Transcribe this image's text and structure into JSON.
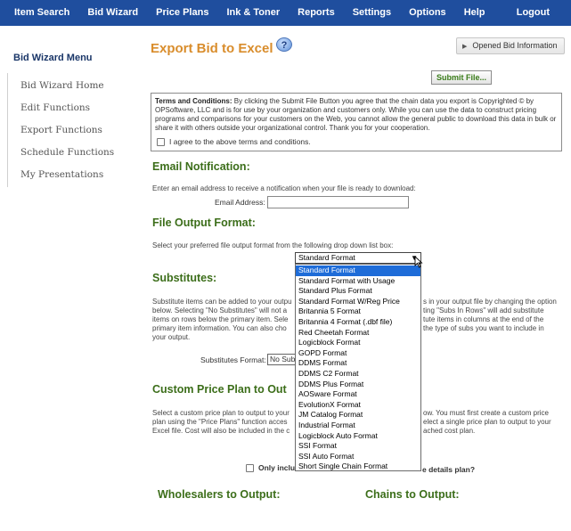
{
  "nav": {
    "items": [
      "Item Search",
      "Bid Wizard",
      "Price Plans",
      "Ink & Toner",
      "Reports",
      "Settings",
      "Options",
      "Help"
    ],
    "logout": "Logout",
    "bg_color": "#1f4e9e"
  },
  "sidebar": {
    "title": "Bid Wizard Menu",
    "items": [
      "Bid Wizard Home",
      "Edit Functions",
      "Export Functions",
      "Schedule Functions",
      "My Presentations"
    ]
  },
  "main": {
    "title": "Export Bid to Excel",
    "help_icon": "?",
    "opened_bid_label": "Opened Bid Information",
    "submit_label": "Submit File...",
    "terms": {
      "heading": "Terms and Conditions:",
      "body": " By clicking the Submit File Button you agree that the chain data you export is Copyrighted © by OPSoftware, LLC and is for use by your organization and customers only. While you can use the data to construct pricing programs and comparisons for your customers on the Web, you cannot allow the general public to download this data in bulk or share it with others outside your organizational control. Thank you for your cooperation.",
      "agree_label": "I agree to the above terms and conditions."
    },
    "email": {
      "heading": "Email Notification:",
      "instructions": "Enter an email address to receive a notification when your file is ready to download:",
      "label": "Email Address:",
      "value": ""
    },
    "file_output": {
      "heading": "File Output Format:",
      "instructions": "Select your preferred file output format from the following drop down list box:",
      "selected": "Standard Format",
      "options": [
        "Standard Format",
        "Standard Format with Usage",
        "Standard Plus Format",
        "Standard Format W/Reg Price",
        "Britannia 5 Format",
        "Britannia 4 Format (.dbf file)",
        "Red Cheetah Format",
        "Logicblock Format",
        "GOPD Format",
        "DDMS Format",
        "DDMS C2 Format",
        "DDMS Plus Format",
        "AOSware Format",
        "EvolutionX Format",
        "JM Catalog Format",
        "Industrial Format",
        "Logicblock Auto Format",
        "SSI Format",
        "SSI Auto Format",
        "Short Single Chain Format"
      ]
    },
    "substitutes": {
      "heading": "Substitutes:",
      "text_left_1": "Substitute items can be added to your outpu",
      "text_right_1": "s in your output file by changing the option",
      "text_left_2": "below. Selecting \"No Substitutes\" will not a",
      "text_right_2": "ting \"Subs In Rows\" will add substitute",
      "text_left_3": "items on rows below the primary item. Sele",
      "text_right_3": "tute items in columns at the end of the",
      "text_left_4": "primary item information. You can also cho",
      "text_right_4": "the type of subs you want to include in",
      "text_left_5": "your output.",
      "format_label": "Substitutes Format:",
      "format_value": "No Sub"
    },
    "custom_plan": {
      "heading": "Custom Price Plan to Out",
      "text_left_1": "Select a custom price plan to output to your",
      "text_right_1": "ow. You must first create a custom price",
      "text_left_2": "plan using the \"Price Plans\" function acces",
      "text_right_2": "elect a single price plan to output to your",
      "text_left_3": "Excel file. Cost will also be included in the c",
      "text_right_3": "ached cost plan.",
      "check_label": "Only include",
      "check_tail": "e details plan?"
    },
    "wholesalers_heading": "Wholesalers to Output:",
    "chains_heading": "Chains to Output:",
    "accent_color": "#d98d2c",
    "section_color": "#3c6e1a",
    "selected_option_color": "#1e6cd8"
  }
}
